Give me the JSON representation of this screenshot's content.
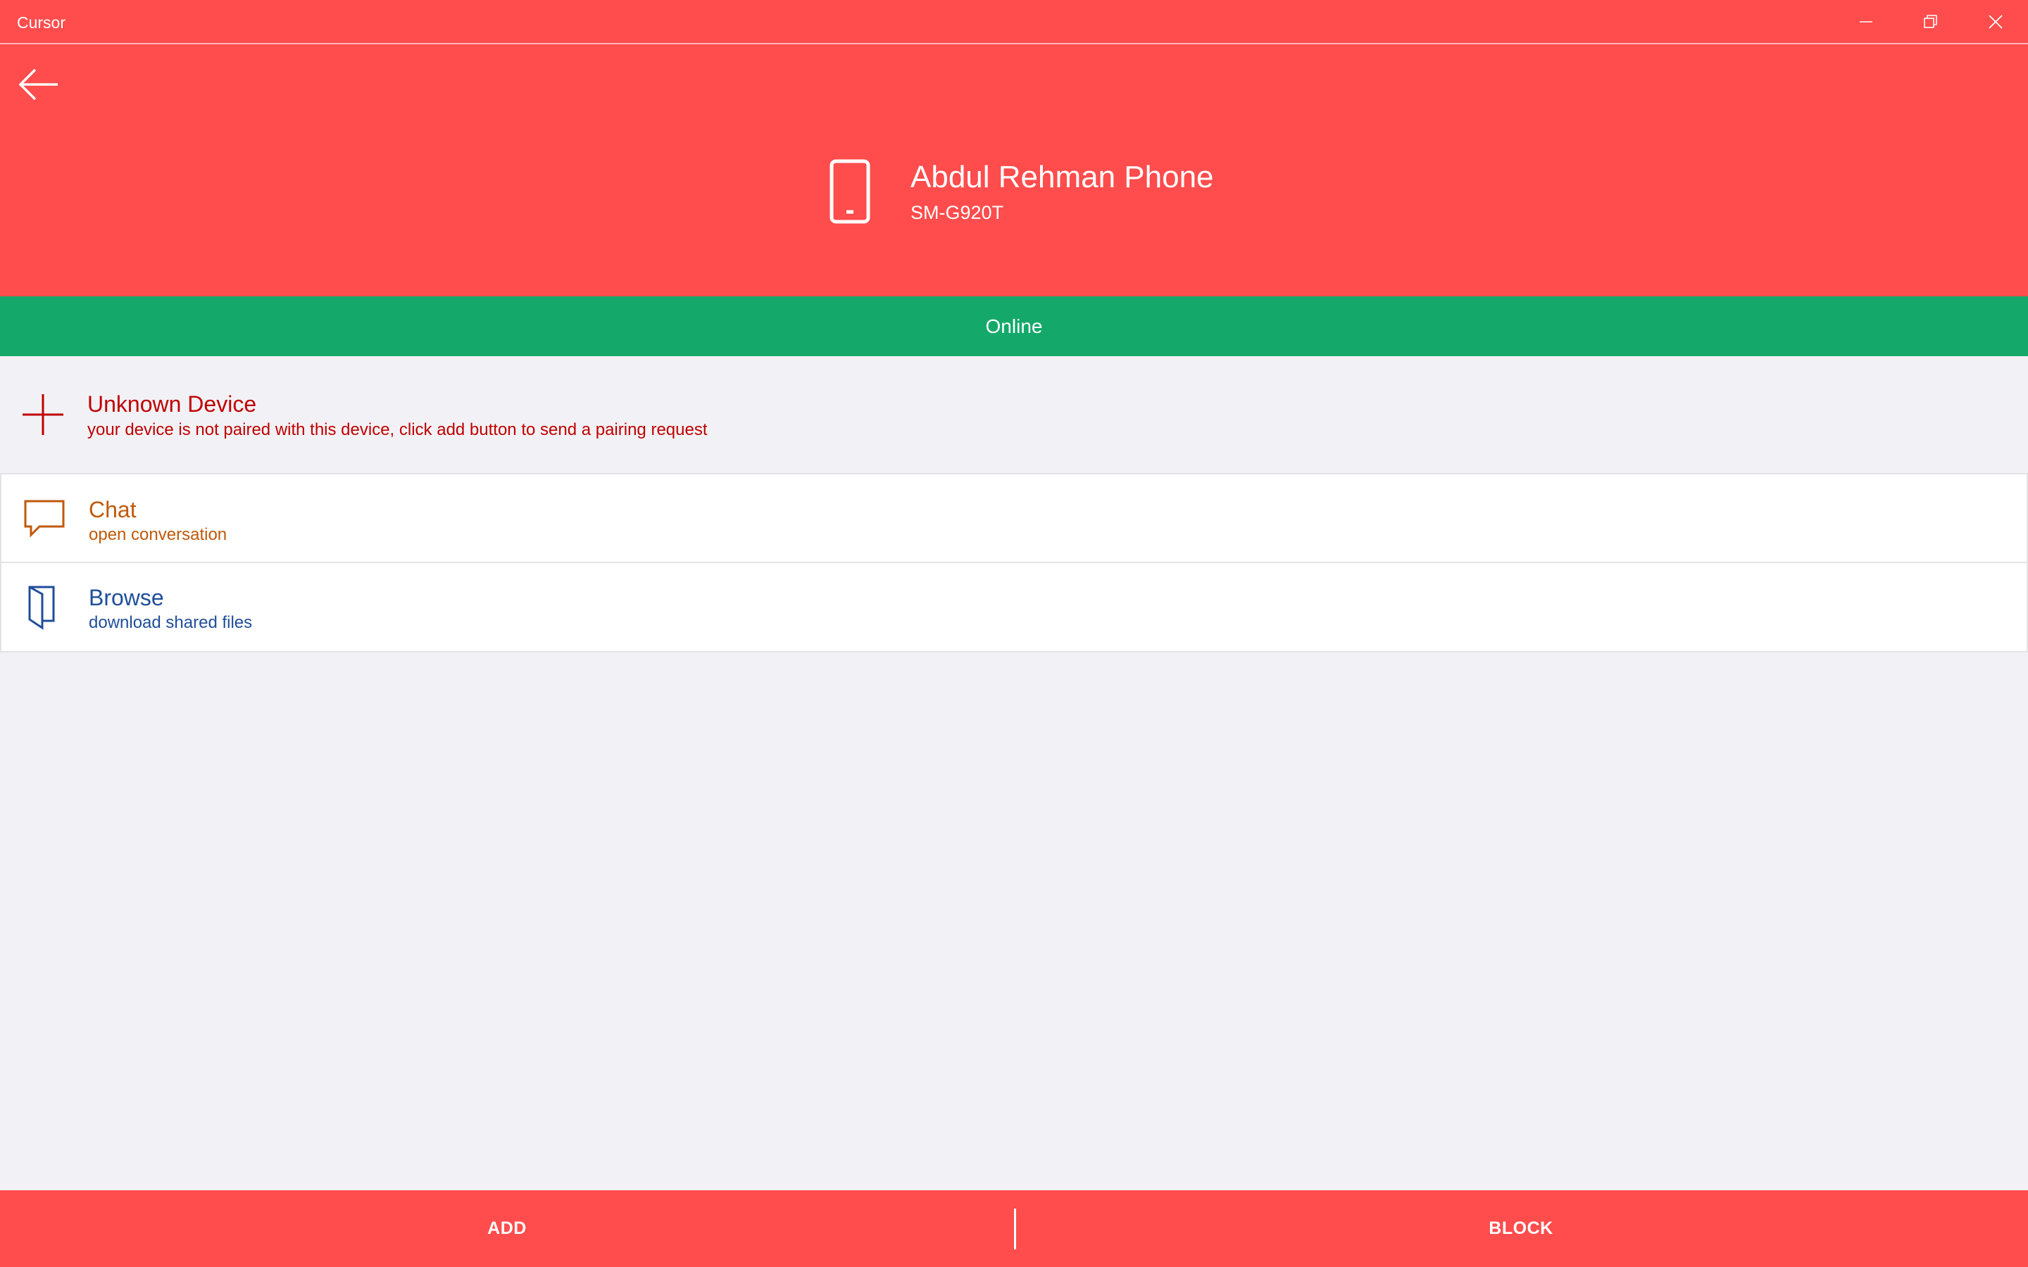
{
  "window": {
    "title": "Cursor",
    "controls": {
      "minimize_icon": "minimize-icon",
      "maximize_icon": "restore-icon",
      "close_icon": "close-icon"
    }
  },
  "header": {
    "back_icon": "back-arrow-icon",
    "device_icon": "phone-icon",
    "device_name": "Abdul Rehman Phone",
    "device_model": "SM-G920T"
  },
  "status": {
    "text": "Online",
    "color": "#14A96A"
  },
  "items": [
    {
      "icon": "add-icon",
      "label": "Unknown Device",
      "sub": "your device is not paired with this device, click add button to send a pairing request",
      "color": "#C00000"
    },
    {
      "icon": "chat-icon",
      "label": "Chat",
      "sub": "open conversation",
      "color": "#C0590A"
    },
    {
      "icon": "folder-icon",
      "label": "Browse",
      "sub": "download shared files",
      "color": "#1F4E9A"
    }
  ],
  "bottom_bar": {
    "add_label": "ADD",
    "block_label": "BLOCK"
  },
  "colors": {
    "accent": "#FF4C4C",
    "background": "#F2F2F6"
  }
}
